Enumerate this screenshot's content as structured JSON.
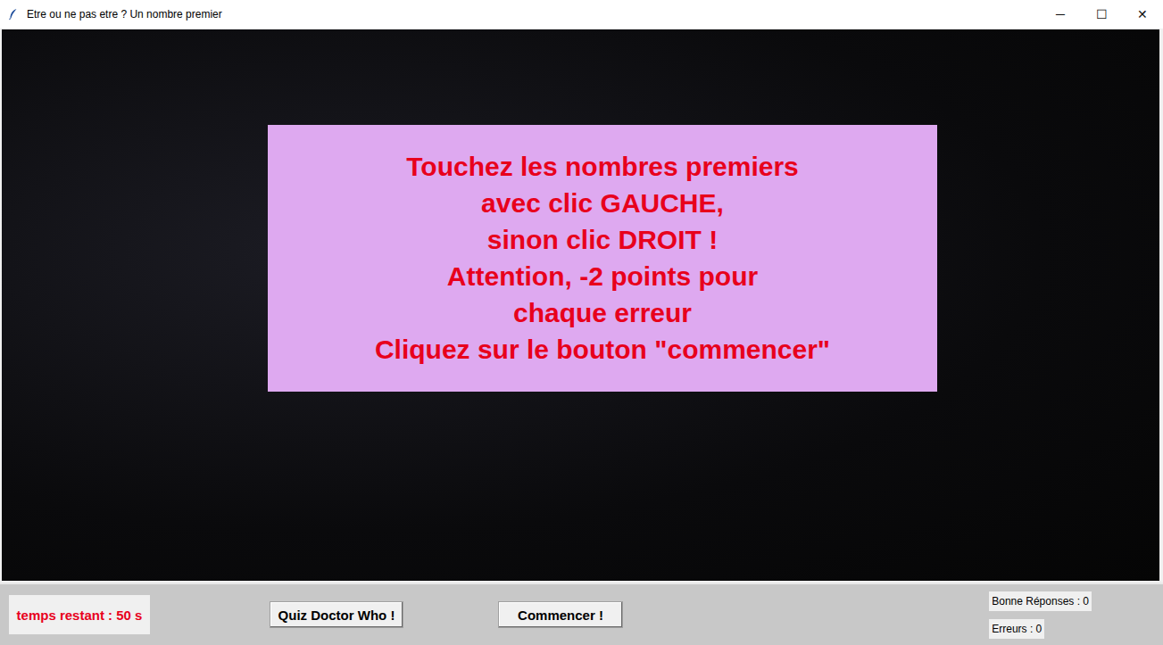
{
  "window": {
    "title": "Etre ou ne pas etre ? Un nombre premier",
    "controls": [
      "─",
      "☐",
      "✕"
    ]
  },
  "instructions": {
    "lines": [
      "Touchez les nombres premiers",
      "avec clic GAUCHE,",
      "sinon clic DROIT !",
      "Attention, -2 points pour",
      "chaque erreur",
      "Cliquez sur le bouton \"commencer\""
    ]
  },
  "status": {
    "timer": "temps restant : 50 s",
    "score": "Bonne Réponses : 0",
    "errors": "Erreurs : 0"
  },
  "buttons": [
    {
      "label": "Quiz Doctor Who !"
    },
    {
      "label": "Commencer !"
    }
  ]
}
